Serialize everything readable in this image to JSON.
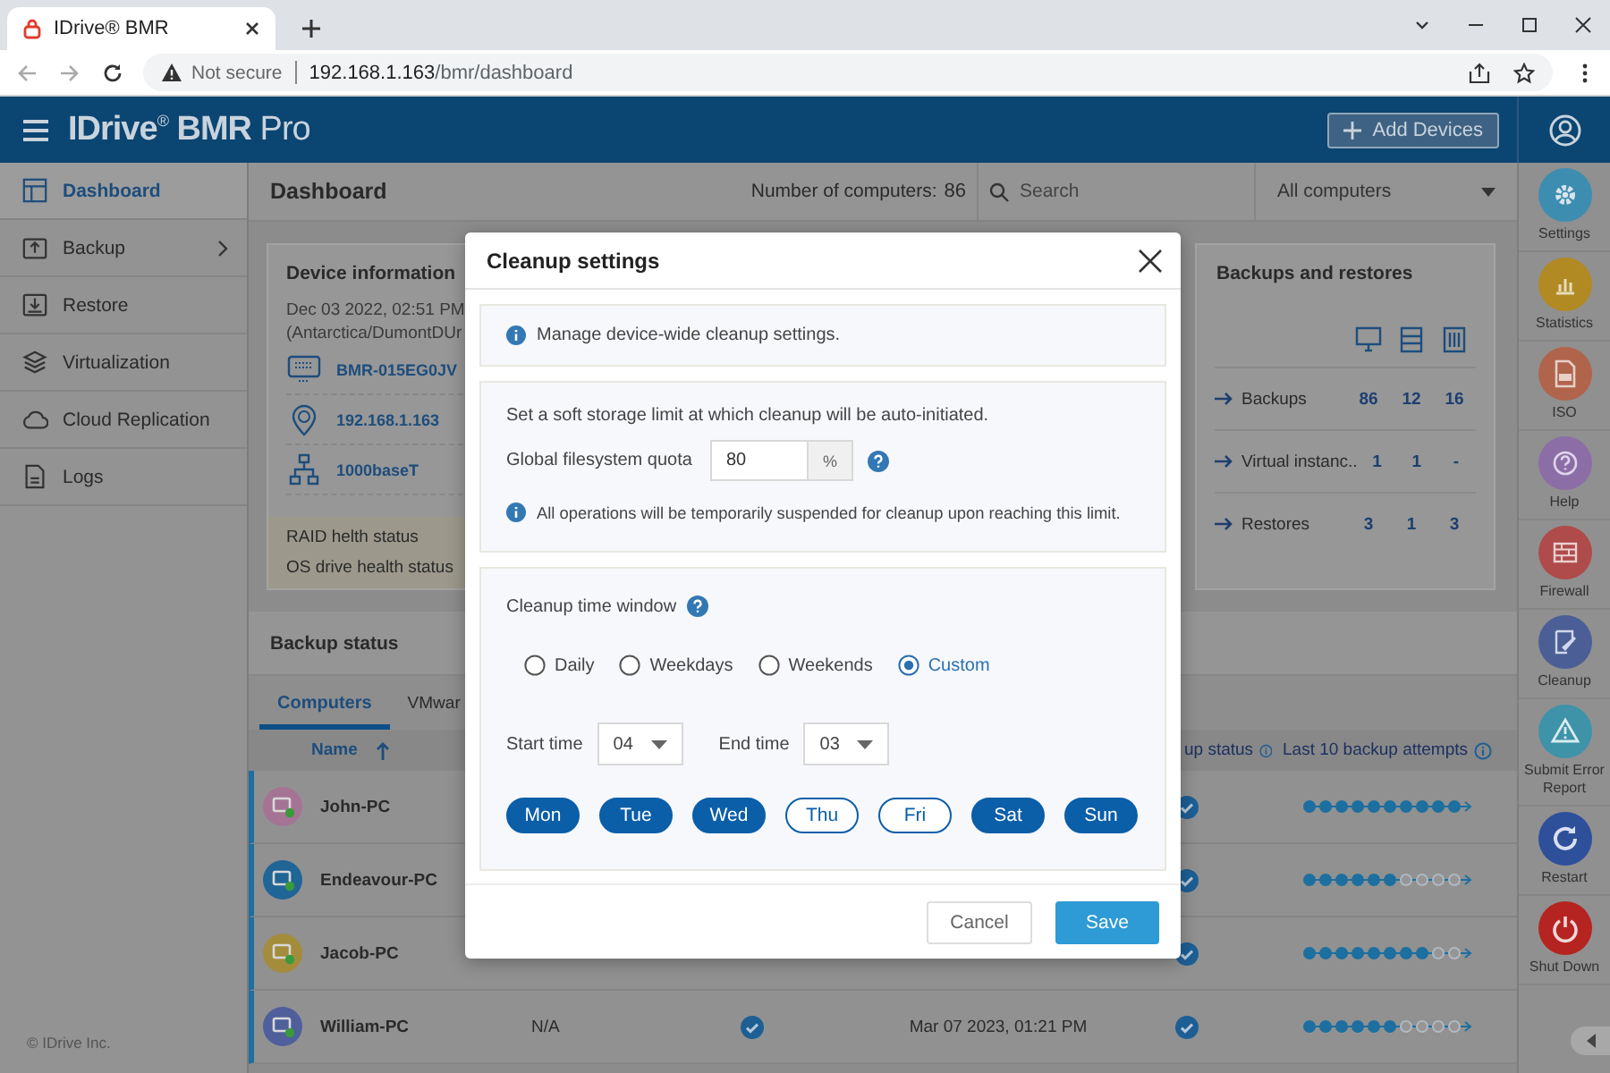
{
  "browser": {
    "tab_title": "IDrive® BMR",
    "security_label": "Not secure",
    "url_host": "192.168.1.163",
    "url_path": "/bmr/dashboard"
  },
  "app_header": {
    "logo": "**IDrive**$^{®}$ **BMR** Pro",
    "add_button": "Add Devices"
  },
  "sidebar": {
    "items": [
      {
        "label": "Dashboard",
        "kind": "dashboard",
        "selected": true,
        "has_submenu": false
      },
      {
        "label": "Backup",
        "kind": "backup",
        "selected": false,
        "has_submenu": true
      },
      {
        "label": "Restore",
        "kind": "restore",
        "selected": false,
        "has_submenu": false
      },
      {
        "label": "Virtualization",
        "kind": "layers",
        "selected": false,
        "has_submenu": false
      },
      {
        "label": "Cloud Replication",
        "kind": "cloud",
        "selected": false,
        "has_submenu": false
      },
      {
        "label": "Logs",
        "kind": "logs",
        "selected": false,
        "has_submenu": false
      }
    ],
    "footer": "© IDrive Inc."
  },
  "dashboard": {
    "title": "Dashboard",
    "count_label": "Number of computers:",
    "count": "86",
    "search_placeholder": "Search",
    "filter": "All computers"
  },
  "device_info": {
    "title": "Device information",
    "date": "Dec 03 2022, 02:51 PM",
    "timezone": "(Antarctica/DumontDUr",
    "items": [
      {
        "kind": "hostname",
        "value": "BMR-015EG0JV"
      },
      {
        "kind": "ip",
        "value": "192.168.1.163"
      },
      {
        "kind": "network",
        "value": "1000baseT"
      }
    ],
    "health": [
      "RAID helth status",
      "OS drive health status"
    ]
  },
  "backups_restores": {
    "title": "Backups and restores",
    "columns": [
      {
        "kind": "computer"
      },
      {
        "kind": "server"
      },
      {
        "kind": "storage"
      }
    ],
    "rows": [
      {
        "label": "Backups",
        "values": [
          "86",
          "12",
          "16"
        ]
      },
      {
        "label": "Virtual instanc..",
        "values": [
          "1",
          "1",
          "-"
        ]
      },
      {
        "label": "Restores",
        "values": [
          "3",
          "1",
          "3"
        ]
      }
    ]
  },
  "backup_status": {
    "title": "Backup status",
    "tabs": [
      {
        "label": "Computers",
        "selected": true
      },
      {
        "label": "VMwar",
        "selected": false
      }
    ],
    "columns": [
      {
        "label": "Name",
        "sorted": true,
        "info": false
      },
      {
        "label": "up status",
        "sorted": false,
        "info": true
      },
      {
        "label": "Last 10 backup attempts",
        "sorted": false,
        "info": true
      }
    ],
    "rows": [
      {
        "name": "John-PC",
        "color": "#a57494",
        "status_ok": true,
        "attempts": [
          true,
          true,
          true,
          true,
          true,
          true,
          true,
          true,
          true,
          true
        ]
      },
      {
        "name": "Endeavour-PC",
        "color": "#1f6596",
        "status_ok": true,
        "attempts": [
          true,
          true,
          true,
          true,
          true,
          true,
          false,
          false,
          false,
          false
        ]
      },
      {
        "name": "Jacob-PC",
        "color": "#a38c3c",
        "status_ok": true,
        "attempts": [
          true,
          true,
          true,
          true,
          true,
          true,
          true,
          true,
          false,
          false
        ]
      },
      {
        "name": "William-PC",
        "color": "#4f5f9c",
        "column_2": "N/A",
        "column_3_ok": true,
        "column_4": "Mar 07 2023, 01:21 PM",
        "status_ok": true,
        "attempts": [
          true,
          true,
          true,
          true,
          true,
          true,
          false,
          false,
          false,
          false
        ]
      }
    ]
  },
  "right_rail": {
    "items": [
      {
        "label": "Settings",
        "kind": "settings",
        "color": "#3d8db0"
      },
      {
        "label": "Statistics",
        "kind": "statistics",
        "color": "#b18a24"
      },
      {
        "label": "ISO",
        "kind": "iso",
        "color": "#b0644b"
      },
      {
        "label": "Help",
        "kind": "help",
        "color": "#8c6ea6"
      },
      {
        "label": "Firewall",
        "kind": "firewall",
        "color": "#b04b4b"
      },
      {
        "label": "Cleanup",
        "kind": "cleanup",
        "color": "#4b5f96"
      },
      {
        "label": "Submit Error Report",
        "kind": "warning",
        "color": "#3f93a9"
      },
      {
        "label": "Restart",
        "kind": "restart",
        "color": "#2e509b"
      },
      {
        "label": "Shut Down",
        "kind": "power",
        "color": "#b52421"
      }
    ]
  },
  "modal": {
    "title": "Cleanup settings",
    "intro": "Manage device-wide cleanup settings.",
    "quota_text": "Set a soft storage limit at which cleanup will be auto-initiated.",
    "quota_label": "Global filesystem quota",
    "quota_value": "80",
    "quota_unit": "%",
    "quota_note": "All operations will be temporarily suspended for cleanup upon reaching this limit.",
    "window_label": "Cleanup time window",
    "options": [
      {
        "label": "Daily",
        "selected": false
      },
      {
        "label": "Weekdays",
        "selected": false
      },
      {
        "label": "Weekends",
        "selected": false
      },
      {
        "label": "Custom",
        "selected": true
      }
    ],
    "start_label": "Start time",
    "start_value": "04",
    "end_label": "End time",
    "end_value": "03",
    "days": [
      {
        "label": "Mon",
        "selected": true
      },
      {
        "label": "Tue",
        "selected": true
      },
      {
        "label": "Wed",
        "selected": true
      },
      {
        "label": "Thu",
        "selected": false
      },
      {
        "label": "Fri",
        "selected": false
      },
      {
        "label": "Sat",
        "selected": true
      },
      {
        "label": "Sun",
        "selected": true
      }
    ],
    "buttons": [
      {
        "label": "Cancel",
        "kind": "secondary"
      },
      {
        "label": "Save",
        "kind": "primary"
      }
    ]
  }
}
